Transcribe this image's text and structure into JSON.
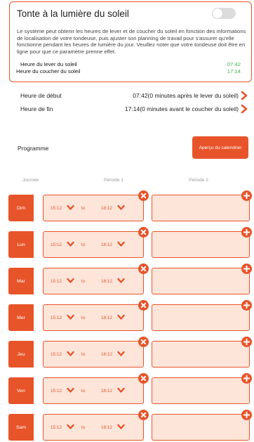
{
  "sunlight": {
    "title": "Tonte à la lumière du soleil",
    "toggle_on": false,
    "description": "Le système peut obtenir les heures de lever et de coucher du soleil en fonction des informations de localisation de votre tondeuse, puis ajuster son planning de travail pour s'assurer qu'elle fonctionne pendant les heures de lumière du jour. Veuillez noter que votre tondeuse doit être en ligne pour que ce paramètre prenne effet.",
    "sunrise_label": "Heure du lever du soleil",
    "sunrise_value": "07:42",
    "sunset_label": "Heure du coucher du soleil",
    "sunset_value": "17:14"
  },
  "start": {
    "label": "Heure de début",
    "value": "07:42(0 minutes après le lever du soleil)"
  },
  "end": {
    "label": "Heure de fin",
    "value": "17:14(0 minutes avant le coucher du soleil)"
  },
  "programme": {
    "label": "Programme",
    "calendar_button": "Aperçu du calendrier"
  },
  "columns": {
    "day": "Journée",
    "period1": "Période 1",
    "period2": "Période 2"
  },
  "days": [
    {
      "name": "Dim",
      "from": "15:12",
      "to_word": "to",
      "to": "18:12"
    },
    {
      "name": "Lun",
      "from": "15:12",
      "to_word": "to",
      "to": "18:12"
    },
    {
      "name": "Mar",
      "from": "15:12",
      "to_word": "to",
      "to": "18:12"
    },
    {
      "name": "Mer",
      "from": "15:12",
      "to_word": "to",
      "to": "18:12"
    },
    {
      "name": "Jeu",
      "from": "15:12",
      "to_word": "to",
      "to": "18:12"
    },
    {
      "name": "Ven",
      "from": "15:12",
      "to_word": "to",
      "to": "18:12"
    },
    {
      "name": "Sam",
      "from": "15:12",
      "to_word": "to",
      "to": "18:12"
    }
  ],
  "colors": {
    "accent": "#e8542a",
    "success": "#3ab54a",
    "period_fill": "#fde5d9",
    "toggle_off": "#dcdcdc"
  }
}
